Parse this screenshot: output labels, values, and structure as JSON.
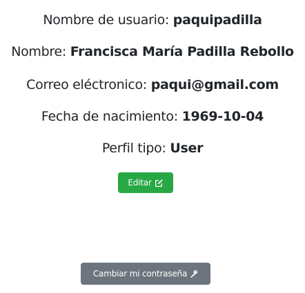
{
  "profile": {
    "username_label": "Nombre de usuario: ",
    "username_value": "paquipadilla",
    "name_label": "Nombre: ",
    "name_value": "Francisca María Padilla Rebollo",
    "email_label": "Correo eléctronico: ",
    "email_value": "paqui@gmail.com",
    "birth_label": "Fecha de nacimiento: ",
    "birth_value": "1969-10-04",
    "profile_type_label": "Perfil tipo: ",
    "profile_type_value": "User"
  },
  "actions": {
    "edit_label": "Editar",
    "edit_icon": "edit-icon",
    "change_password_label": "Cambiar mi contraseña",
    "change_password_icon": "key-icon"
  },
  "colors": {
    "edit_button": "#28a745",
    "password_button": "#6c757d",
    "text": "#212529"
  }
}
